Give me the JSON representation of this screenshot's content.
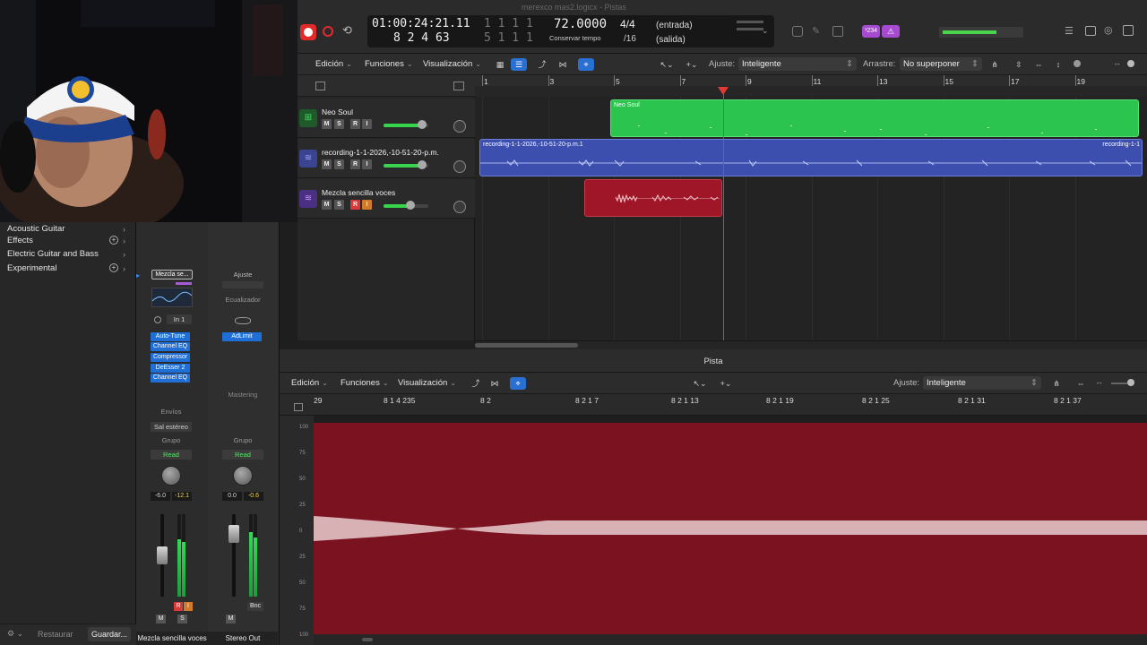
{
  "window_title": "merexco mas2.logicx - Pistas",
  "colors": {
    "record_red": "#e22a2a",
    "accent_blue": "#2a6fd2",
    "green_region": "#2bc44e",
    "blue_region": "#3d4fae",
    "red_region": "#a01629",
    "editor_bg": "#7a1220"
  },
  "control_bar": {
    "time_smpte": "01:00:24:21.11",
    "time_beats": "8  2  4    63",
    "time_dim_top": "1  1  1     1",
    "time_dim_bottom": "5  1  1     1",
    "tempo": "72.0000",
    "tempo_label": "Conservar tempo",
    "sig_top": "4/4",
    "sig_bottom": "/16",
    "entrada": "(entrada)",
    "salida": "(salida)",
    "count_in": "¹234"
  },
  "tracks_toolbar": {
    "edicion": "Edición",
    "funciones": "Funciones",
    "visualizacion": "Visualización",
    "ajuste_label": "Ajuste:",
    "ajuste_value": "Inteligente",
    "arrastre_label": "Arrastre:",
    "arrastre_value": "No superponer"
  },
  "tracks": [
    {
      "name": "Neo Soul",
      "m": "M",
      "s": "S",
      "r": "R",
      "i": "I",
      "volume": 0.85
    },
    {
      "name": "recording-1-1-2026,-10-51-20-p.m.",
      "m": "M",
      "s": "S",
      "r": "R",
      "i": "I",
      "volume": 0.85
    },
    {
      "name": "Mezcla sencilla voces",
      "m": "M",
      "s": "S",
      "r": "R",
      "i": "I",
      "volume": 0.6
    }
  ],
  "ruler_bars": [
    "1",
    "3",
    "5",
    "7",
    "9",
    "11",
    "13",
    "15",
    "17",
    "19"
  ],
  "regions": {
    "neo_soul": "Neo Soul",
    "recording": "recording-1-1-2026,-10-51-20-p.m.1",
    "recording_tail": "recording-1-1"
  },
  "library": {
    "items": [
      "Acoustic Guitar",
      "Effects",
      "Electric Guitar and Bass",
      "Experimental"
    ],
    "restaurar": "Restaurar",
    "guardar": "Guardar..."
  },
  "mixer": {
    "strip1": {
      "setting": "Mezcla se...",
      "input": "In 1",
      "plugins": [
        "Auto-Tune",
        "Channel EQ",
        "Compressor",
        "DeEsser 2",
        "Channel EQ"
      ],
      "envios": "Envíos",
      "output": "Sal estéreo",
      "group": "Grupo",
      "automation": "Read",
      "pan_value": "-6.0",
      "peak_value": "-12.1",
      "m": "M",
      "s": "S",
      "r": "R",
      "i": "I",
      "name": "Mezcla sencilla voces"
    },
    "strip2": {
      "setting": "Ajuste",
      "eq_label": "Ecualizador",
      "plugins": [
        "AdLimit"
      ],
      "mastering": "Mastering",
      "group": "Grupo",
      "automation": "Read",
      "pan_value": "0.0",
      "peak_value": "-0.6",
      "bnc": "Bnc",
      "m": "M",
      "name": "Stereo Out"
    }
  },
  "editor": {
    "title": "Pista",
    "edicion": "Edición",
    "funciones": "Funciones",
    "visualizacion": "Visualización",
    "ajuste_label": "Ajuste:",
    "ajuste_value": "Inteligente",
    "ruler": [
      "29",
      "8 1 4 235",
      "8 2",
      "8 2 1 7",
      "8 2 1 13",
      "8 2 1 19",
      "8 2 1 25",
      "8 2 1 31",
      "8 2 1 37"
    ],
    "db_labels": [
      "100",
      "75",
      "50",
      "25",
      "0",
      "25",
      "50",
      "75",
      "100"
    ]
  }
}
